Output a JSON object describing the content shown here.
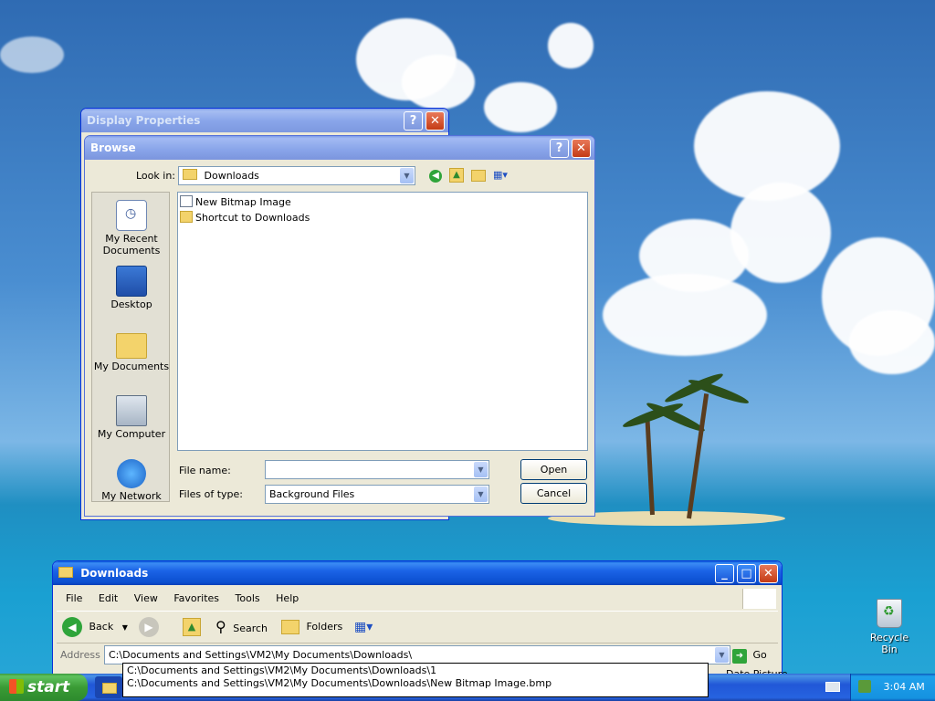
{
  "desktop": {
    "icons": [
      {
        "label": "Recycle Bin",
        "icon": "recycle-bin-icon"
      }
    ]
  },
  "display_properties": {
    "title": "Display Properties",
    "help": "?",
    "close": "✕"
  },
  "browse": {
    "title": "Browse",
    "help": "?",
    "close": "✕",
    "look_in_label": "Look in:",
    "look_in_value": "Downloads",
    "places": [
      {
        "label": "My Recent Documents",
        "icon": "recent-documents-icon"
      },
      {
        "label": "Desktop",
        "icon": "desktop-icon"
      },
      {
        "label": "My Documents",
        "icon": "my-documents-icon"
      },
      {
        "label": "My Computer",
        "icon": "my-computer-icon"
      },
      {
        "label": "My Network",
        "icon": "my-network-icon"
      }
    ],
    "files": [
      {
        "name": "New Bitmap Image",
        "icon": "bitmap-file-icon"
      },
      {
        "name": "Shortcut to Downloads",
        "icon": "folder-shortcut-icon"
      }
    ],
    "file_name_label": "File name:",
    "file_name_value": "",
    "files_of_type_label": "Files of type:",
    "files_of_type_value": "Background Files",
    "open_button": "Open",
    "cancel_button": "Cancel"
  },
  "explorer": {
    "title": "Downloads",
    "menu": [
      "File",
      "Edit",
      "View",
      "Favorites",
      "Tools",
      "Help"
    ],
    "toolbar": {
      "back": "Back",
      "search": "Search",
      "folders": "Folders"
    },
    "address_label": "Address",
    "address_value": "C:\\Documents and Settings\\VM2\\My Documents\\Downloads\\",
    "go_button": "Go",
    "autocomplete": [
      "C:\\Documents and Settings\\VM2\\My Documents\\Downloads\\1",
      "C:\\Documents and Settings\\VM2\\My Documents\\Downloads\\New Bitmap Image.bmp"
    ],
    "partial_column": "Date Picture"
  },
  "taskbar": {
    "start_label": "start",
    "clock": "3:04 AM"
  }
}
